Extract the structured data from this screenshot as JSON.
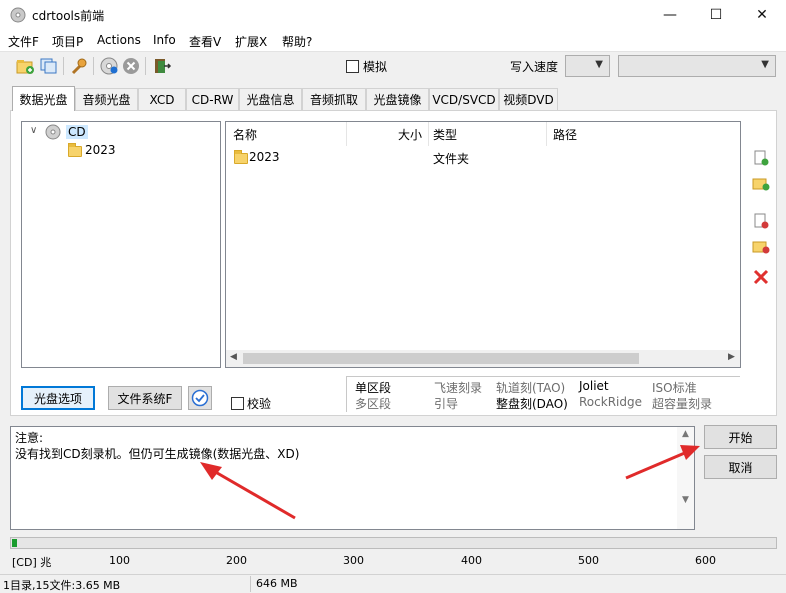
{
  "window": {
    "title": "cdrtools前端",
    "minimize": "—",
    "maximize": "☐",
    "close": "✕"
  },
  "menu": [
    "文件F",
    "项目P",
    "Actions",
    "Info",
    "查看V",
    "扩展X",
    "帮助?"
  ],
  "toolbar": {
    "simulate_label": "模拟",
    "write_speed_label": "写入速度",
    "speed_value": "",
    "device_value": ""
  },
  "tabs": [
    "数据光盘",
    "音频光盘",
    "XCD",
    "CD-RW",
    "光盘信息",
    "音频抓取",
    "光盘镜像",
    "VCD/SVCD",
    "视频DVD"
  ],
  "active_tab": 0,
  "tree": {
    "root": "CD",
    "children": [
      "2023"
    ]
  },
  "list": {
    "headers": [
      "名称",
      "大小",
      "类型",
      "路径"
    ],
    "rows": [
      {
        "name": "2023",
        "size": "",
        "type": "文件夹",
        "path": ""
      }
    ]
  },
  "buttons": {
    "disc_options": "光盘选项",
    "filesystem": "文件系统F",
    "verify": "校验",
    "start": "开始",
    "cancel": "取消"
  },
  "options": {
    "row1": [
      "单区段",
      "飞速刻录",
      "轨道刻(TAO)",
      "Joliet",
      "ISO标准"
    ],
    "row2": [
      "多区段",
      "引导",
      "整盘刻(DAO)",
      "RockRidge",
      "超容量刻录"
    ]
  },
  "notes": {
    "title": "注意:",
    "message": "没有找到CD刻录机。但仍可生成镜像(数据光盘、XD)"
  },
  "scale": {
    "unit_label": "[CD] 兆",
    "ticks": [
      "100",
      "200",
      "300",
      "400",
      "500",
      "600"
    ]
  },
  "progress_fraction": 0.006,
  "status": {
    "summary": "1目录,15文件:3.65 MB",
    "size": "646 MB"
  },
  "colors": {
    "accent": "#0078d7",
    "arrow": "#e02a2a",
    "progress": "#1a9c2e"
  }
}
